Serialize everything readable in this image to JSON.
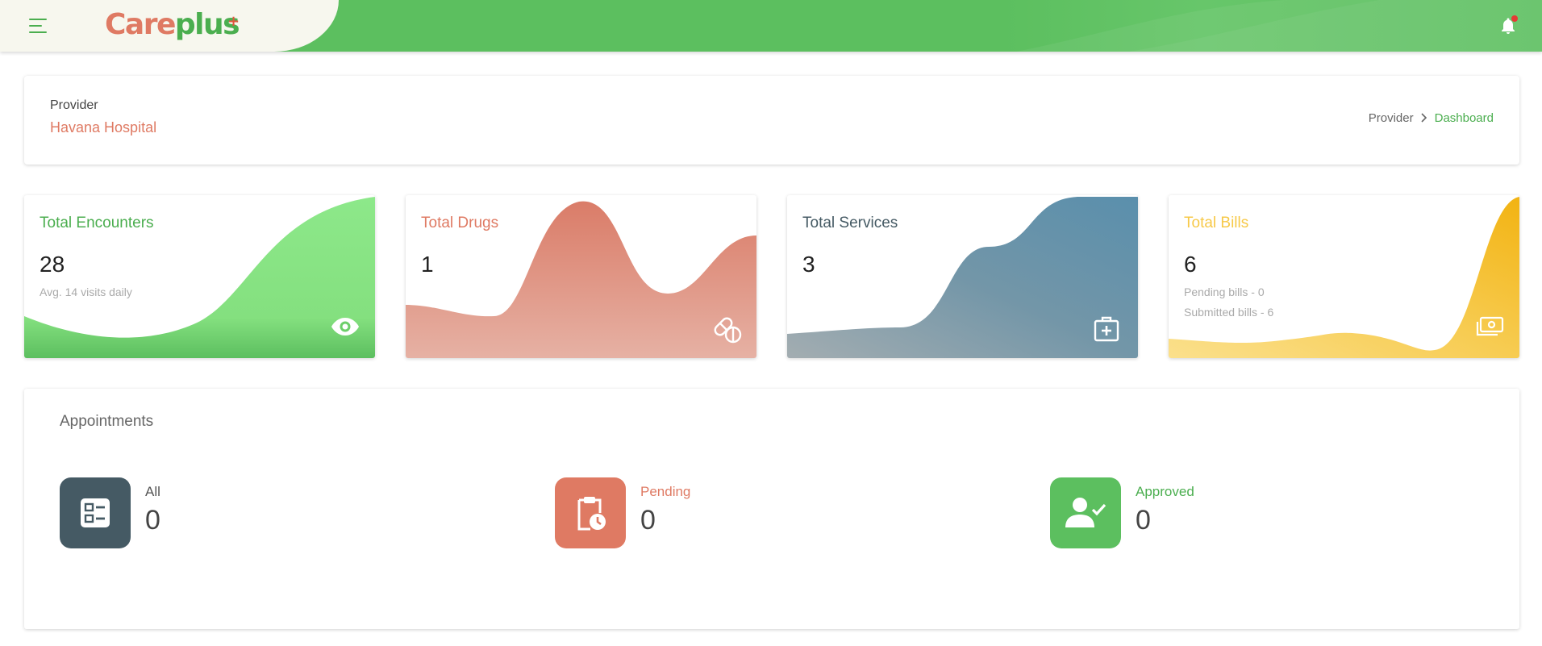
{
  "topbar": {
    "logo_part1": "Care",
    "logo_part2": "plus",
    "logo_plus": "+",
    "accent_color": "#5cbf5f"
  },
  "header": {
    "label": "Provider",
    "provider_name": "Havana Hospital",
    "breadcrumb": {
      "items": [
        "Provider",
        "Dashboard"
      ],
      "separator": "›"
    }
  },
  "stats": [
    {
      "title": "Total Encounters",
      "count": "28",
      "sub": [
        "Avg. 14 visits daily"
      ],
      "color": "#4bae4f",
      "icon": "eye-icon"
    },
    {
      "title": "Total Drugs",
      "count": "1",
      "sub": [],
      "color": "#df7a63",
      "icon": "pills-icon"
    },
    {
      "title": "Total Services",
      "count": "3",
      "sub": [],
      "color": "#455a64",
      "icon": "medical-kit-icon"
    },
    {
      "title": "Total Bills",
      "count": "6",
      "sub": [
        "Pending bills - 0",
        "Submitted bills - 6"
      ],
      "color": "#f7c948",
      "icon": "money-icon"
    }
  ],
  "appointments": {
    "title": "Appointments",
    "items": [
      {
        "label": "All",
        "count": "0",
        "color": "#455a64",
        "icon": "list-icon"
      },
      {
        "label": "Pending",
        "count": "0",
        "color": "#df7a63",
        "icon": "clipboard-clock-icon"
      },
      {
        "label": "Approved",
        "count": "0",
        "color": "#5cbf5f",
        "icon": "user-check-icon"
      }
    ]
  }
}
